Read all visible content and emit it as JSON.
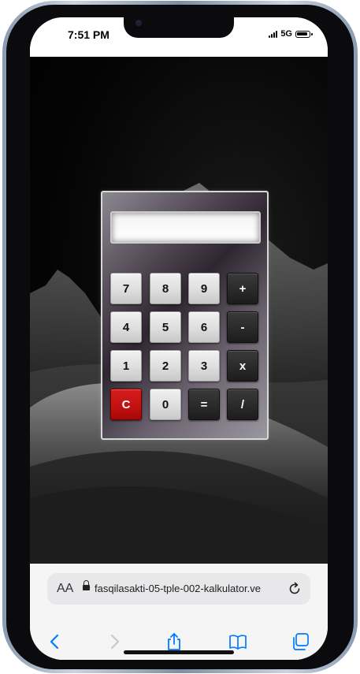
{
  "status": {
    "time": "7:51 PM",
    "network": "5G"
  },
  "calculator": {
    "display": "",
    "keys": [
      {
        "label": "7",
        "type": "num"
      },
      {
        "label": "8",
        "type": "num"
      },
      {
        "label": "9",
        "type": "num"
      },
      {
        "label": "+",
        "type": "op"
      },
      {
        "label": "4",
        "type": "num"
      },
      {
        "label": "5",
        "type": "num"
      },
      {
        "label": "6",
        "type": "num"
      },
      {
        "label": "-",
        "type": "op"
      },
      {
        "label": "1",
        "type": "num"
      },
      {
        "label": "2",
        "type": "num"
      },
      {
        "label": "3",
        "type": "num"
      },
      {
        "label": "x",
        "type": "op"
      },
      {
        "label": "C",
        "type": "clr"
      },
      {
        "label": "0",
        "type": "num"
      },
      {
        "label": "=",
        "type": "op"
      },
      {
        "label": "/",
        "type": "op"
      }
    ]
  },
  "browser": {
    "aa_label": "AA",
    "url": "fasqilasakti-05-tple-002-kalkulator.ve"
  },
  "icons": {
    "back": "chevron-left-icon",
    "forward": "chevron-right-icon",
    "share": "share-icon",
    "bookmarks": "book-icon",
    "tabs": "tabs-icon",
    "reload": "reload-icon",
    "lock": "lock-icon"
  },
  "colors": {
    "accent": "#007aff",
    "clear_key": "#c91414",
    "operator_key": "#2a2a2a"
  }
}
